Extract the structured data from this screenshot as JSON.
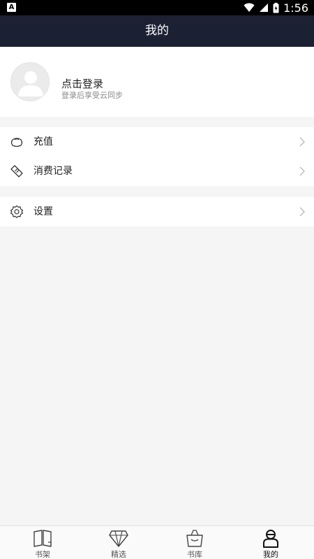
{
  "status_bar": {
    "left_badge": "A",
    "time": "1:56"
  },
  "header": {
    "title": "我的"
  },
  "profile": {
    "name": "点击登录",
    "subtitle": "登录后享受云同步"
  },
  "menu": {
    "recharge": "充值",
    "records": "消费记录",
    "settings": "设置"
  },
  "tabs": [
    {
      "label": "书架",
      "icon": "bookshelf-icon"
    },
    {
      "label": "精选",
      "icon": "diamond-icon"
    },
    {
      "label": "书库",
      "icon": "bag-icon"
    },
    {
      "label": "我的",
      "icon": "person-icon",
      "active": true
    }
  ]
}
